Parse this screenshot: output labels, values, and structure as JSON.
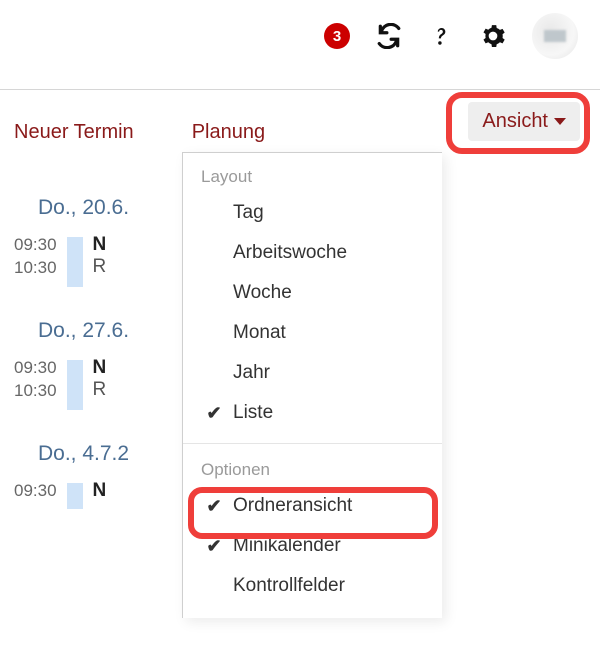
{
  "topbar": {
    "notification_count": "3"
  },
  "actions": {
    "new_event": "Neuer Termin",
    "planning": "Planung",
    "view_button": "Ansicht"
  },
  "events": [
    {
      "date": "Do., 20.6.",
      "start": "09:30",
      "end": "10:30",
      "title_initial": "N",
      "location_initial": "R"
    },
    {
      "date": "Do., 27.6.",
      "start": "09:30",
      "end": "10:30",
      "title_initial": "N",
      "location_initial": "R"
    },
    {
      "date": "Do., 4.7.2",
      "start": "09:30",
      "end": "",
      "title_initial": "N",
      "location_initial": ""
    }
  ],
  "dropdown": {
    "section_layout": "Layout",
    "section_options": "Optionen",
    "layout_items": [
      {
        "label": "Tag",
        "checked": false
      },
      {
        "label": "Arbeitswoche",
        "checked": false
      },
      {
        "label": "Woche",
        "checked": false
      },
      {
        "label": "Monat",
        "checked": false
      },
      {
        "label": "Jahr",
        "checked": false
      },
      {
        "label": "Liste",
        "checked": true
      }
    ],
    "option_items": [
      {
        "label": "Ordneransicht",
        "checked": true
      },
      {
        "label": "Minikalender",
        "checked": true
      },
      {
        "label": "Kontrollfelder",
        "checked": false
      }
    ]
  }
}
